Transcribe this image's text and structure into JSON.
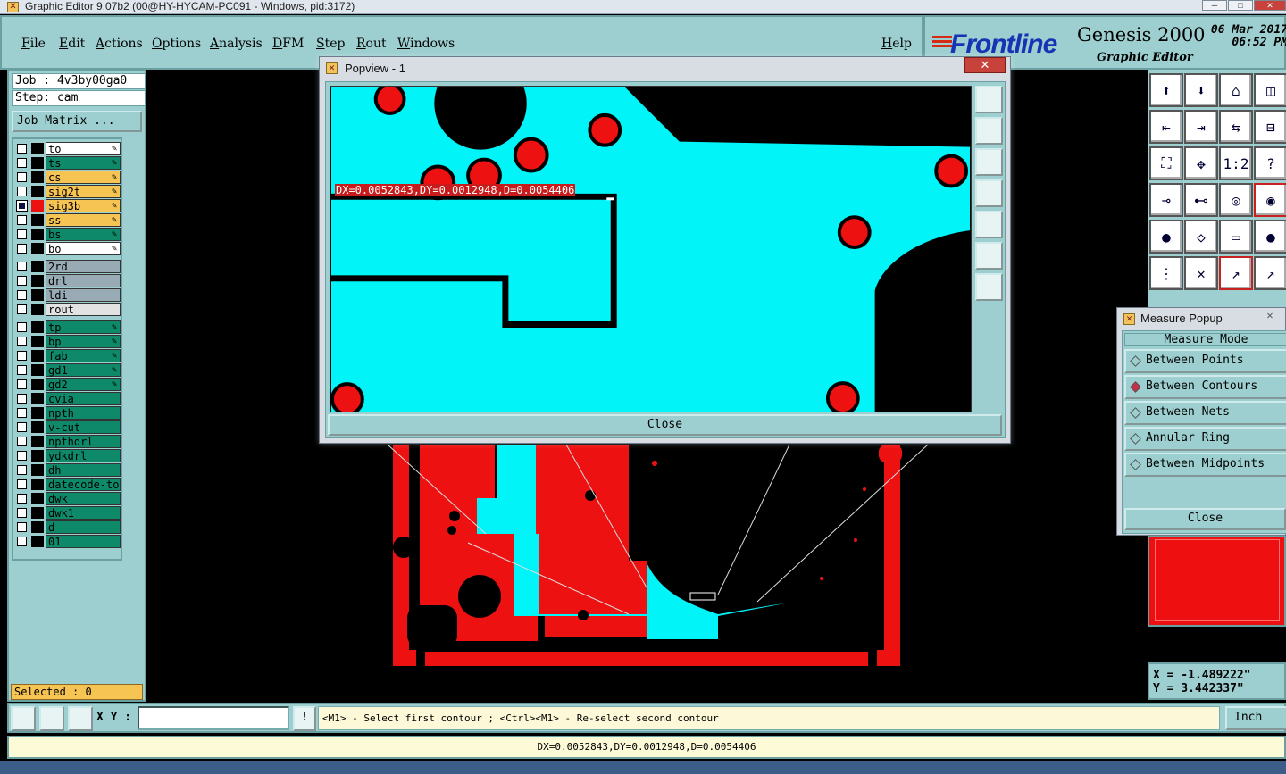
{
  "titlebar": {
    "title": "Graphic Editor 9.07b2 (00@HY-HYCAM-PC091 - Windows, pid:3172)"
  },
  "menu": {
    "items": [
      "File",
      "Edit",
      "Actions",
      "Options",
      "Analysis",
      "DFM",
      "Step",
      "Rout",
      "Windows"
    ],
    "help": "Help"
  },
  "logo": {
    "brand": "Frontline",
    "product": "Genesis 2000",
    "subtitle": "Graphic Editor",
    "date": "06 Mar 2017",
    "time": "06:52 PM"
  },
  "job": {
    "job_line": "Job : 4v3by00ga0",
    "step_line": "Step: cam",
    "matrix_label": "Job Matrix ..."
  },
  "layers": [
    {
      "name": "to",
      "bg": "#ffffff",
      "color": "#000000",
      "editable": true
    },
    {
      "name": "ts",
      "bg": "#0e8a6a",
      "color": "#000000",
      "editable": true
    },
    {
      "name": "cs",
      "bg": "#f6c452",
      "color": "#000000",
      "editable": true
    },
    {
      "name": "sig2t",
      "bg": "#f6c452",
      "color": "#000000",
      "editable": true
    },
    {
      "name": "sig3b",
      "bg": "#f6c452",
      "color": "#ee1111",
      "editable": true,
      "active": true
    },
    {
      "name": "ss",
      "bg": "#f6c452",
      "color": "#000000",
      "editable": true
    },
    {
      "name": "bs",
      "bg": "#0e8a6a",
      "color": "#000000",
      "editable": true
    },
    {
      "name": "bo",
      "bg": "#ffffff",
      "color": "#000000",
      "editable": true
    },
    {
      "name": "2rd",
      "bg": "#98aab4",
      "color": "#000000",
      "editable": false
    },
    {
      "name": "drl",
      "bg": "#98aab4",
      "color": "#000000",
      "editable": false
    },
    {
      "name": "ldi",
      "bg": "#98aab4",
      "color": "#000000",
      "editable": false
    },
    {
      "name": "rout",
      "bg": "#e2e2e2",
      "color": "#000000",
      "editable": false
    },
    {
      "name": "tp",
      "bg": "#0e8a6a",
      "color": "#000000",
      "editable": true
    },
    {
      "name": "bp",
      "bg": "#0e8a6a",
      "color": "#000000",
      "editable": true
    },
    {
      "name": "fab",
      "bg": "#0e8a6a",
      "color": "#000000",
      "editable": true
    },
    {
      "name": "gd1",
      "bg": "#0e8a6a",
      "color": "#000000",
      "editable": true
    },
    {
      "name": "gd2",
      "bg": "#0e8a6a",
      "color": "#000000",
      "editable": true
    },
    {
      "name": "cvia",
      "bg": "#0e8a6a",
      "color": "#000000",
      "editable": false
    },
    {
      "name": "npth",
      "bg": "#0e8a6a",
      "color": "#000000",
      "editable": false
    },
    {
      "name": "v-cut",
      "bg": "#0e8a6a",
      "color": "#000000",
      "editable": false
    },
    {
      "name": "npthdrl",
      "bg": "#0e8a6a",
      "color": "#000000",
      "editable": false
    },
    {
      "name": "ydkdrl",
      "bg": "#0e8a6a",
      "color": "#000000",
      "editable": false
    },
    {
      "name": "dh",
      "bg": "#0e8a6a",
      "color": "#000000",
      "editable": false
    },
    {
      "name": "datecode-to",
      "bg": "#0e8a6a",
      "color": "#000000",
      "editable": false
    },
    {
      "name": "dwk",
      "bg": "#0e8a6a",
      "color": "#000000",
      "editable": false
    },
    {
      "name": "dwk1",
      "bg": "#0e8a6a",
      "color": "#000000",
      "editable": false
    },
    {
      "name": "d",
      "bg": "#0e8a6a",
      "color": "#000000",
      "editable": false
    },
    {
      "name": "01",
      "bg": "#0e8a6a",
      "color": "#000000",
      "editable": false
    }
  ],
  "selected_label": "Selected : 0",
  "popview": {
    "title": "Popview - 1",
    "measure_text": "DX=0.0052843,DY=0.0012948,D=0.0054406",
    "close_label": "Close",
    "close_x": "✕"
  },
  "measure_popup": {
    "title": "Measure Popup",
    "x": "✕",
    "mode_header": "Measure Mode",
    "options": [
      {
        "label": "Between Points",
        "selected": false
      },
      {
        "label": "Between Contours",
        "selected": true
      },
      {
        "label": "Between Nets",
        "selected": false
      },
      {
        "label": "Annular Ring",
        "selected": false
      },
      {
        "label": "Between Midpoints",
        "selected": false
      }
    ],
    "close_label": "Close"
  },
  "coords": {
    "x_line": "X = -1.489222\"",
    "y_line": "Y = 3.442337\""
  },
  "command": {
    "xy_label": "X Y :",
    "xy_value": "",
    "bang": "!",
    "message": "<M1> - Select first contour ; <Ctrl><M1> - Re-select second contour",
    "units": "Inch"
  },
  "status": {
    "text": "DX=0.0052843,DY=0.0012948,D=0.0054406"
  },
  "colors": {
    "copper": "#ee1111",
    "highlight": "#00f4f8",
    "panel": "#9dcfd0",
    "accent_logo": "#1832b4"
  }
}
